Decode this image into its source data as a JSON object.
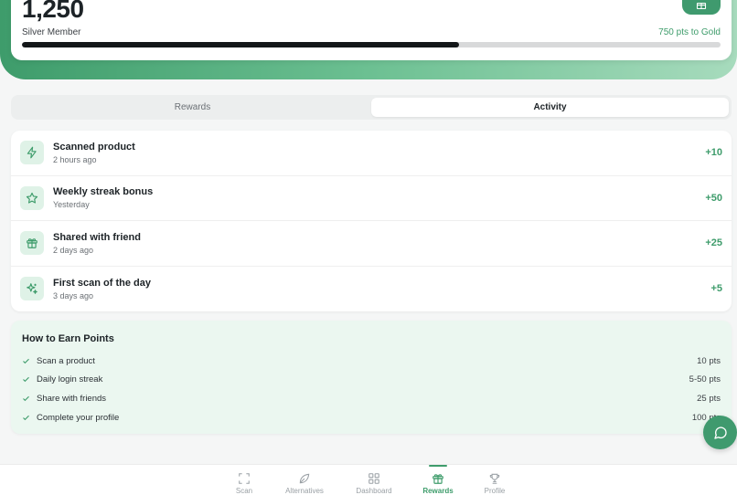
{
  "points": {
    "value": "1,250",
    "tier": "Silver Member",
    "next_tier": "750 pts to Gold",
    "progress_fraction": 0.625
  },
  "tabs": [
    {
      "label": "Rewards",
      "active": false
    },
    {
      "label": "Activity",
      "active": true
    }
  ],
  "activity": [
    {
      "icon": "lightning-icon",
      "title": "Scanned product",
      "time": "2 hours ago",
      "points": "+10"
    },
    {
      "icon": "star-icon",
      "title": "Weekly streak bonus",
      "time": "Yesterday",
      "points": "+50"
    },
    {
      "icon": "gift-icon",
      "title": "Shared with friend",
      "time": "2 days ago",
      "points": "+25"
    },
    {
      "icon": "sparkles-icon",
      "title": "First scan of the day",
      "time": "3 days ago",
      "points": "+5"
    }
  ],
  "earn": {
    "title": "How to Earn Points",
    "items": [
      {
        "label": "Scan a product",
        "value": "10 pts"
      },
      {
        "label": "Daily login streak",
        "value": "5-50 pts"
      },
      {
        "label": "Share with friends",
        "value": "25 pts"
      },
      {
        "label": "Complete your profile",
        "value": "100 pts"
      }
    ]
  },
  "nav": [
    {
      "label": "Scan",
      "icon": "scan-icon",
      "active": false
    },
    {
      "label": "Alternatives",
      "icon": "leaf-icon",
      "active": false
    },
    {
      "label": "Dashboard",
      "icon": "grid-icon",
      "active": false
    },
    {
      "label": "Rewards",
      "icon": "gift-icon",
      "active": true
    },
    {
      "label": "Profile",
      "icon": "trophy-icon",
      "active": false
    }
  ],
  "colors": {
    "accent": "#3e9c6b",
    "accent_light": "#dff2e7",
    "earn_bg": "#ebf7f0"
  }
}
